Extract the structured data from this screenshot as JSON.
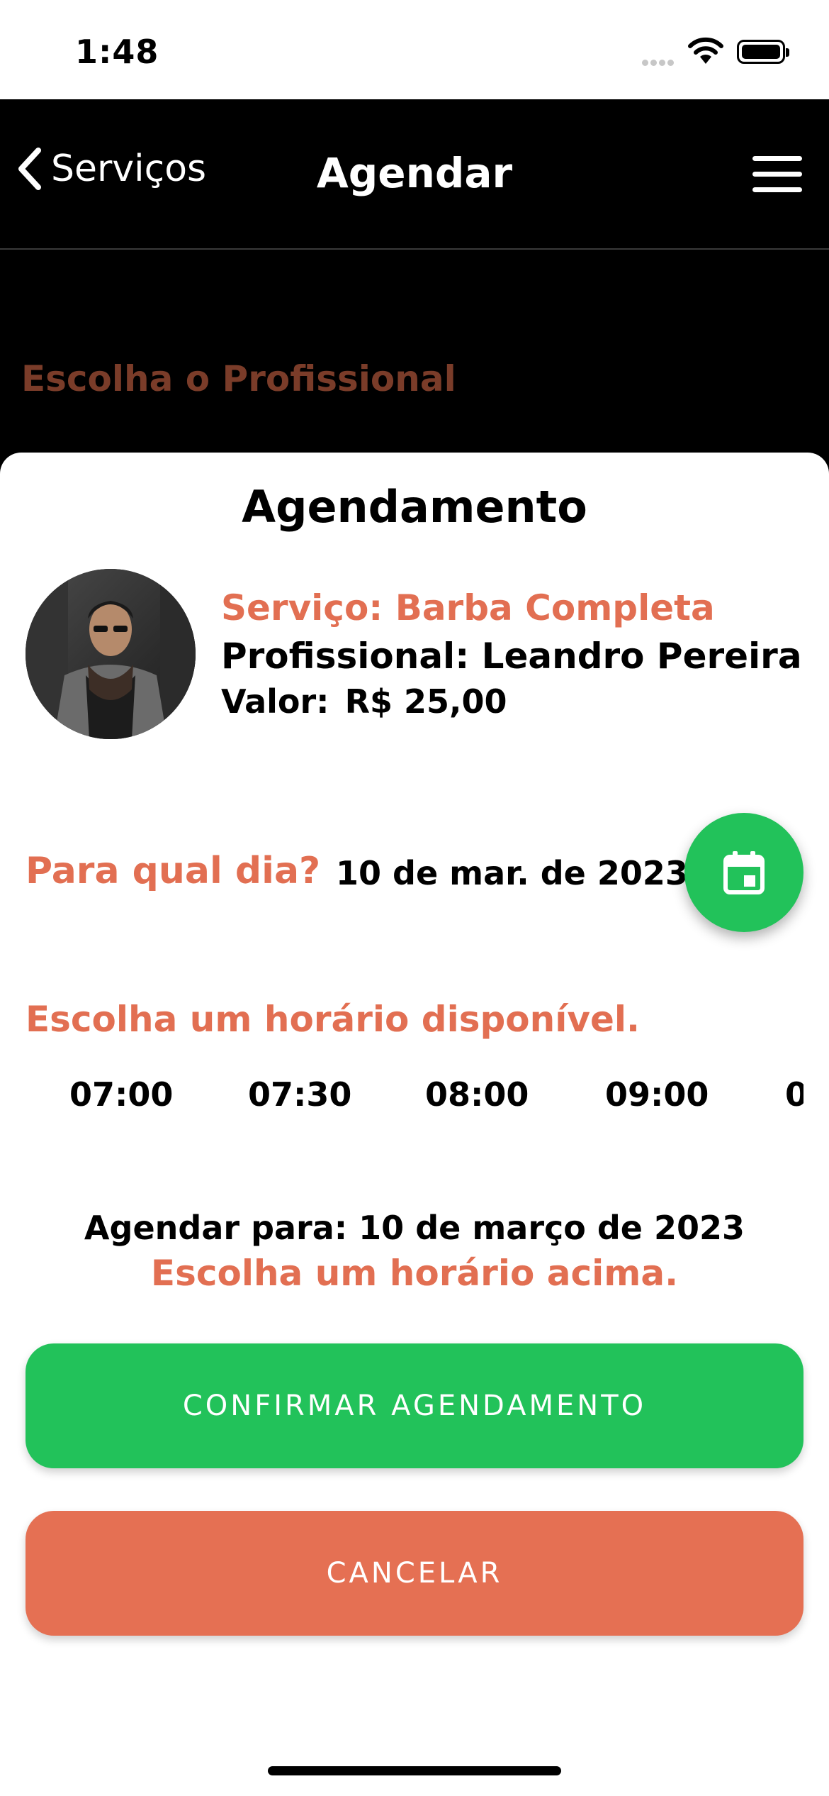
{
  "status_bar": {
    "time": "1:48"
  },
  "nav": {
    "back_label": "Serviços",
    "title": "Agendar"
  },
  "background": {
    "heading": "Escolha o Profissional"
  },
  "modal": {
    "title": "Agendamento",
    "service": "Serviço: Barba Completa",
    "professional": "Profissional: Leandro Pereira",
    "value_label": "Valor:",
    "value": "R$ 25,00",
    "day_question": "Para qual dia?",
    "day_value": "10 de mar. de 2023",
    "time_question": "Escolha um horário disponível.",
    "time_slots": [
      "07:00",
      "07:30",
      "08:00",
      "09:00",
      "0"
    ],
    "summary": "Agendar para: 10 de março de 2023",
    "pick_hint": "Escolha um horário acima.",
    "confirm_label": "CONFIRMAR AGENDAMENTO",
    "cancel_label": "CANCELAR"
  },
  "colors": {
    "accent": "#e26f52",
    "confirm": "#22c25a",
    "cancel": "#e57053"
  }
}
